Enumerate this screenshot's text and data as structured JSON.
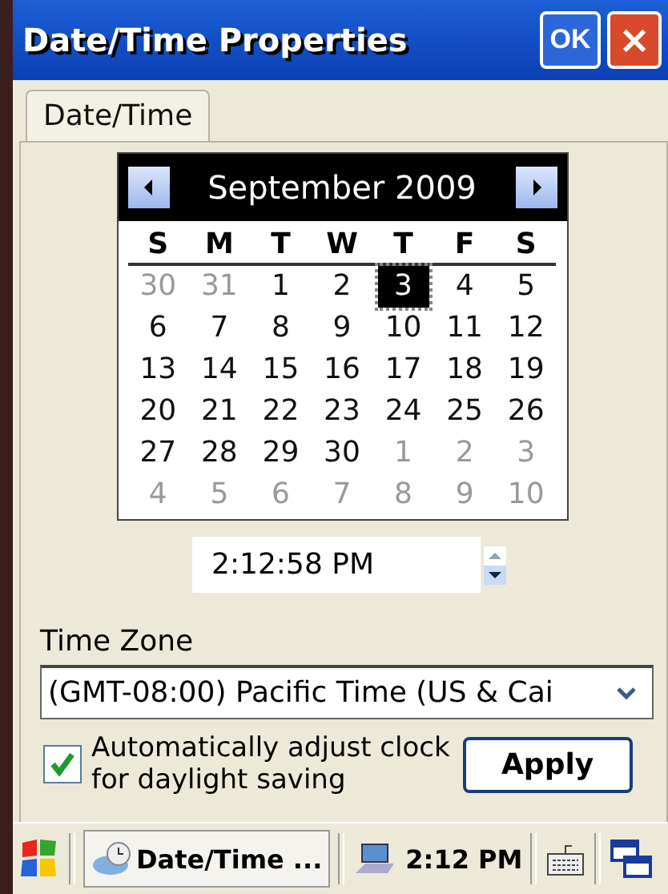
{
  "window": {
    "title": "Date/Time Properties",
    "ok_label": "OK",
    "close_label": "×"
  },
  "tabs": [
    {
      "label": "Date/Time",
      "selected": true
    }
  ],
  "calendar": {
    "month": "September 2009",
    "weekdays": [
      "S",
      "M",
      "T",
      "W",
      "T",
      "F",
      "S"
    ],
    "days": [
      {
        "label": "30",
        "muted": true,
        "selected": false
      },
      {
        "label": "31",
        "muted": true,
        "selected": false
      },
      {
        "label": "1",
        "muted": false,
        "selected": false
      },
      {
        "label": "2",
        "muted": false,
        "selected": false
      },
      {
        "label": "3",
        "muted": false,
        "selected": true
      },
      {
        "label": "4",
        "muted": false,
        "selected": false
      },
      {
        "label": "5",
        "muted": false,
        "selected": false
      },
      {
        "label": "6",
        "muted": false,
        "selected": false
      },
      {
        "label": "7",
        "muted": false,
        "selected": false
      },
      {
        "label": "8",
        "muted": false,
        "selected": false
      },
      {
        "label": "9",
        "muted": false,
        "selected": false
      },
      {
        "label": "10",
        "muted": false,
        "selected": false
      },
      {
        "label": "11",
        "muted": false,
        "selected": false
      },
      {
        "label": "12",
        "muted": false,
        "selected": false
      },
      {
        "label": "13",
        "muted": false,
        "selected": false
      },
      {
        "label": "14",
        "muted": false,
        "selected": false
      },
      {
        "label": "15",
        "muted": false,
        "selected": false
      },
      {
        "label": "16",
        "muted": false,
        "selected": false
      },
      {
        "label": "17",
        "muted": false,
        "selected": false
      },
      {
        "label": "18",
        "muted": false,
        "selected": false
      },
      {
        "label": "19",
        "muted": false,
        "selected": false
      },
      {
        "label": "20",
        "muted": false,
        "selected": false
      },
      {
        "label": "21",
        "muted": false,
        "selected": false
      },
      {
        "label": "22",
        "muted": false,
        "selected": false
      },
      {
        "label": "23",
        "muted": false,
        "selected": false
      },
      {
        "label": "24",
        "muted": false,
        "selected": false
      },
      {
        "label": "25",
        "muted": false,
        "selected": false
      },
      {
        "label": "26",
        "muted": false,
        "selected": false
      },
      {
        "label": "27",
        "muted": false,
        "selected": false
      },
      {
        "label": "28",
        "muted": false,
        "selected": false
      },
      {
        "label": "29",
        "muted": false,
        "selected": false
      },
      {
        "label": "30",
        "muted": false,
        "selected": false
      },
      {
        "label": "1",
        "muted": true,
        "selected": false
      },
      {
        "label": "2",
        "muted": true,
        "selected": false
      },
      {
        "label": "3",
        "muted": true,
        "selected": false
      },
      {
        "label": "4",
        "muted": true,
        "selected": false
      },
      {
        "label": "5",
        "muted": true,
        "selected": false
      },
      {
        "label": "6",
        "muted": true,
        "selected": false
      },
      {
        "label": "7",
        "muted": true,
        "selected": false
      },
      {
        "label": "8",
        "muted": true,
        "selected": false
      },
      {
        "label": "9",
        "muted": true,
        "selected": false
      },
      {
        "label": "10",
        "muted": true,
        "selected": false
      }
    ]
  },
  "time": {
    "value": "2:12:58 PM"
  },
  "time_zone": {
    "label": "Time Zone",
    "value": "(GMT-08:00) Pacific Time (US & Cai"
  },
  "daylight": {
    "label": "Automatically adjust clock for daylight saving",
    "checked": true
  },
  "apply_button": "Apply",
  "taskbar": {
    "task": "Date/Time ...",
    "clock": "2:12 PM"
  }
}
